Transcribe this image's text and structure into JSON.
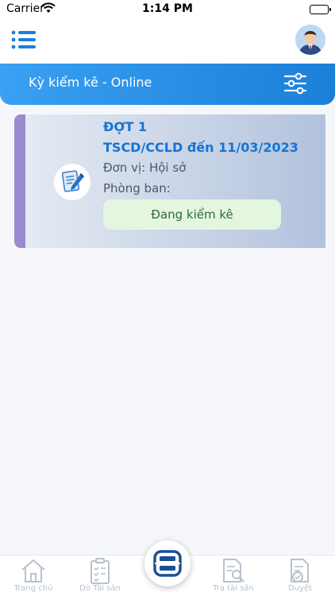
{
  "status_bar": {
    "carrier": "Carrier",
    "time": "1:14 PM"
  },
  "header": {
    "menu_icon": "menu-icon",
    "avatar": "user-avatar"
  },
  "title_bar": {
    "title": "Kỳ kiểm kê - Online",
    "filter_icon": "filter-sliders-icon"
  },
  "inventory_card": {
    "round": "ĐỢT 1",
    "asset": "TSCD/CCLD đến 11/03/2023",
    "unit": "Đơn vị: Hội sở",
    "department": "Phòng ban:",
    "status": "Đang kiểm kê",
    "icon": "document-pen-icon"
  },
  "tab_bar": {
    "items": [
      {
        "label": "Trang chủ",
        "icon": "home-icon"
      },
      {
        "label": "Dò Tài sản",
        "icon": "checklist-icon"
      },
      {
        "label": "",
        "icon": "scan-icon"
      },
      {
        "label": "Tra tài sản",
        "icon": "search-document-icon"
      },
      {
        "label": "Duyệt",
        "icon": "approve-document-icon"
      }
    ]
  },
  "colors": {
    "primary": "#1a80d8",
    "accent_bar": "#9b8bce",
    "status_badge_bg": "#e4f6df",
    "title_text": "#1673d4"
  }
}
